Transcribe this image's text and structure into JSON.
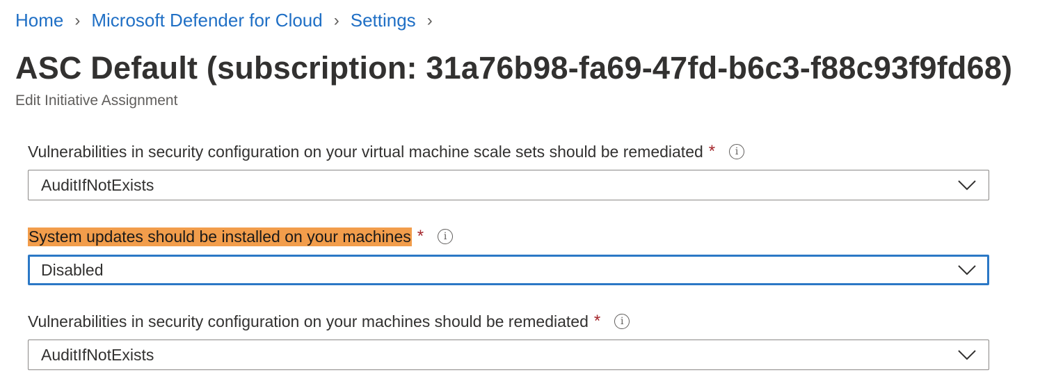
{
  "breadcrumb": [
    "Home",
    "Microsoft Defender for Cloud",
    "Settings"
  ],
  "title": "ASC Default (subscription: 31a76b98-fa69-47fd-b6c3-f88c93f9fd68)",
  "subtitle": "Edit Initiative Assignment",
  "fields": [
    {
      "label": "Vulnerabilities in security configuration on your virtual machine scale sets should be remediated",
      "required": "*",
      "value": "AuditIfNotExists",
      "highlighted": false,
      "focused": false
    },
    {
      "label": "System updates should be installed on your machines",
      "required": "*",
      "value": "Disabled",
      "highlighted": true,
      "focused": true
    },
    {
      "label": "Vulnerabilities in security configuration on your machines should be remediated",
      "required": "*",
      "value": "AuditIfNotExists",
      "highlighted": false,
      "focused": false
    }
  ],
  "colors": {
    "link": "#1f6fc5",
    "highlight": "#f29d4b",
    "focus_border": "#2b78c6",
    "required": "#a4262c"
  },
  "icons": {
    "info": "info-icon",
    "chevron": "chevron-down-icon",
    "breadcrumb_separator": "chevron-right-icon"
  }
}
